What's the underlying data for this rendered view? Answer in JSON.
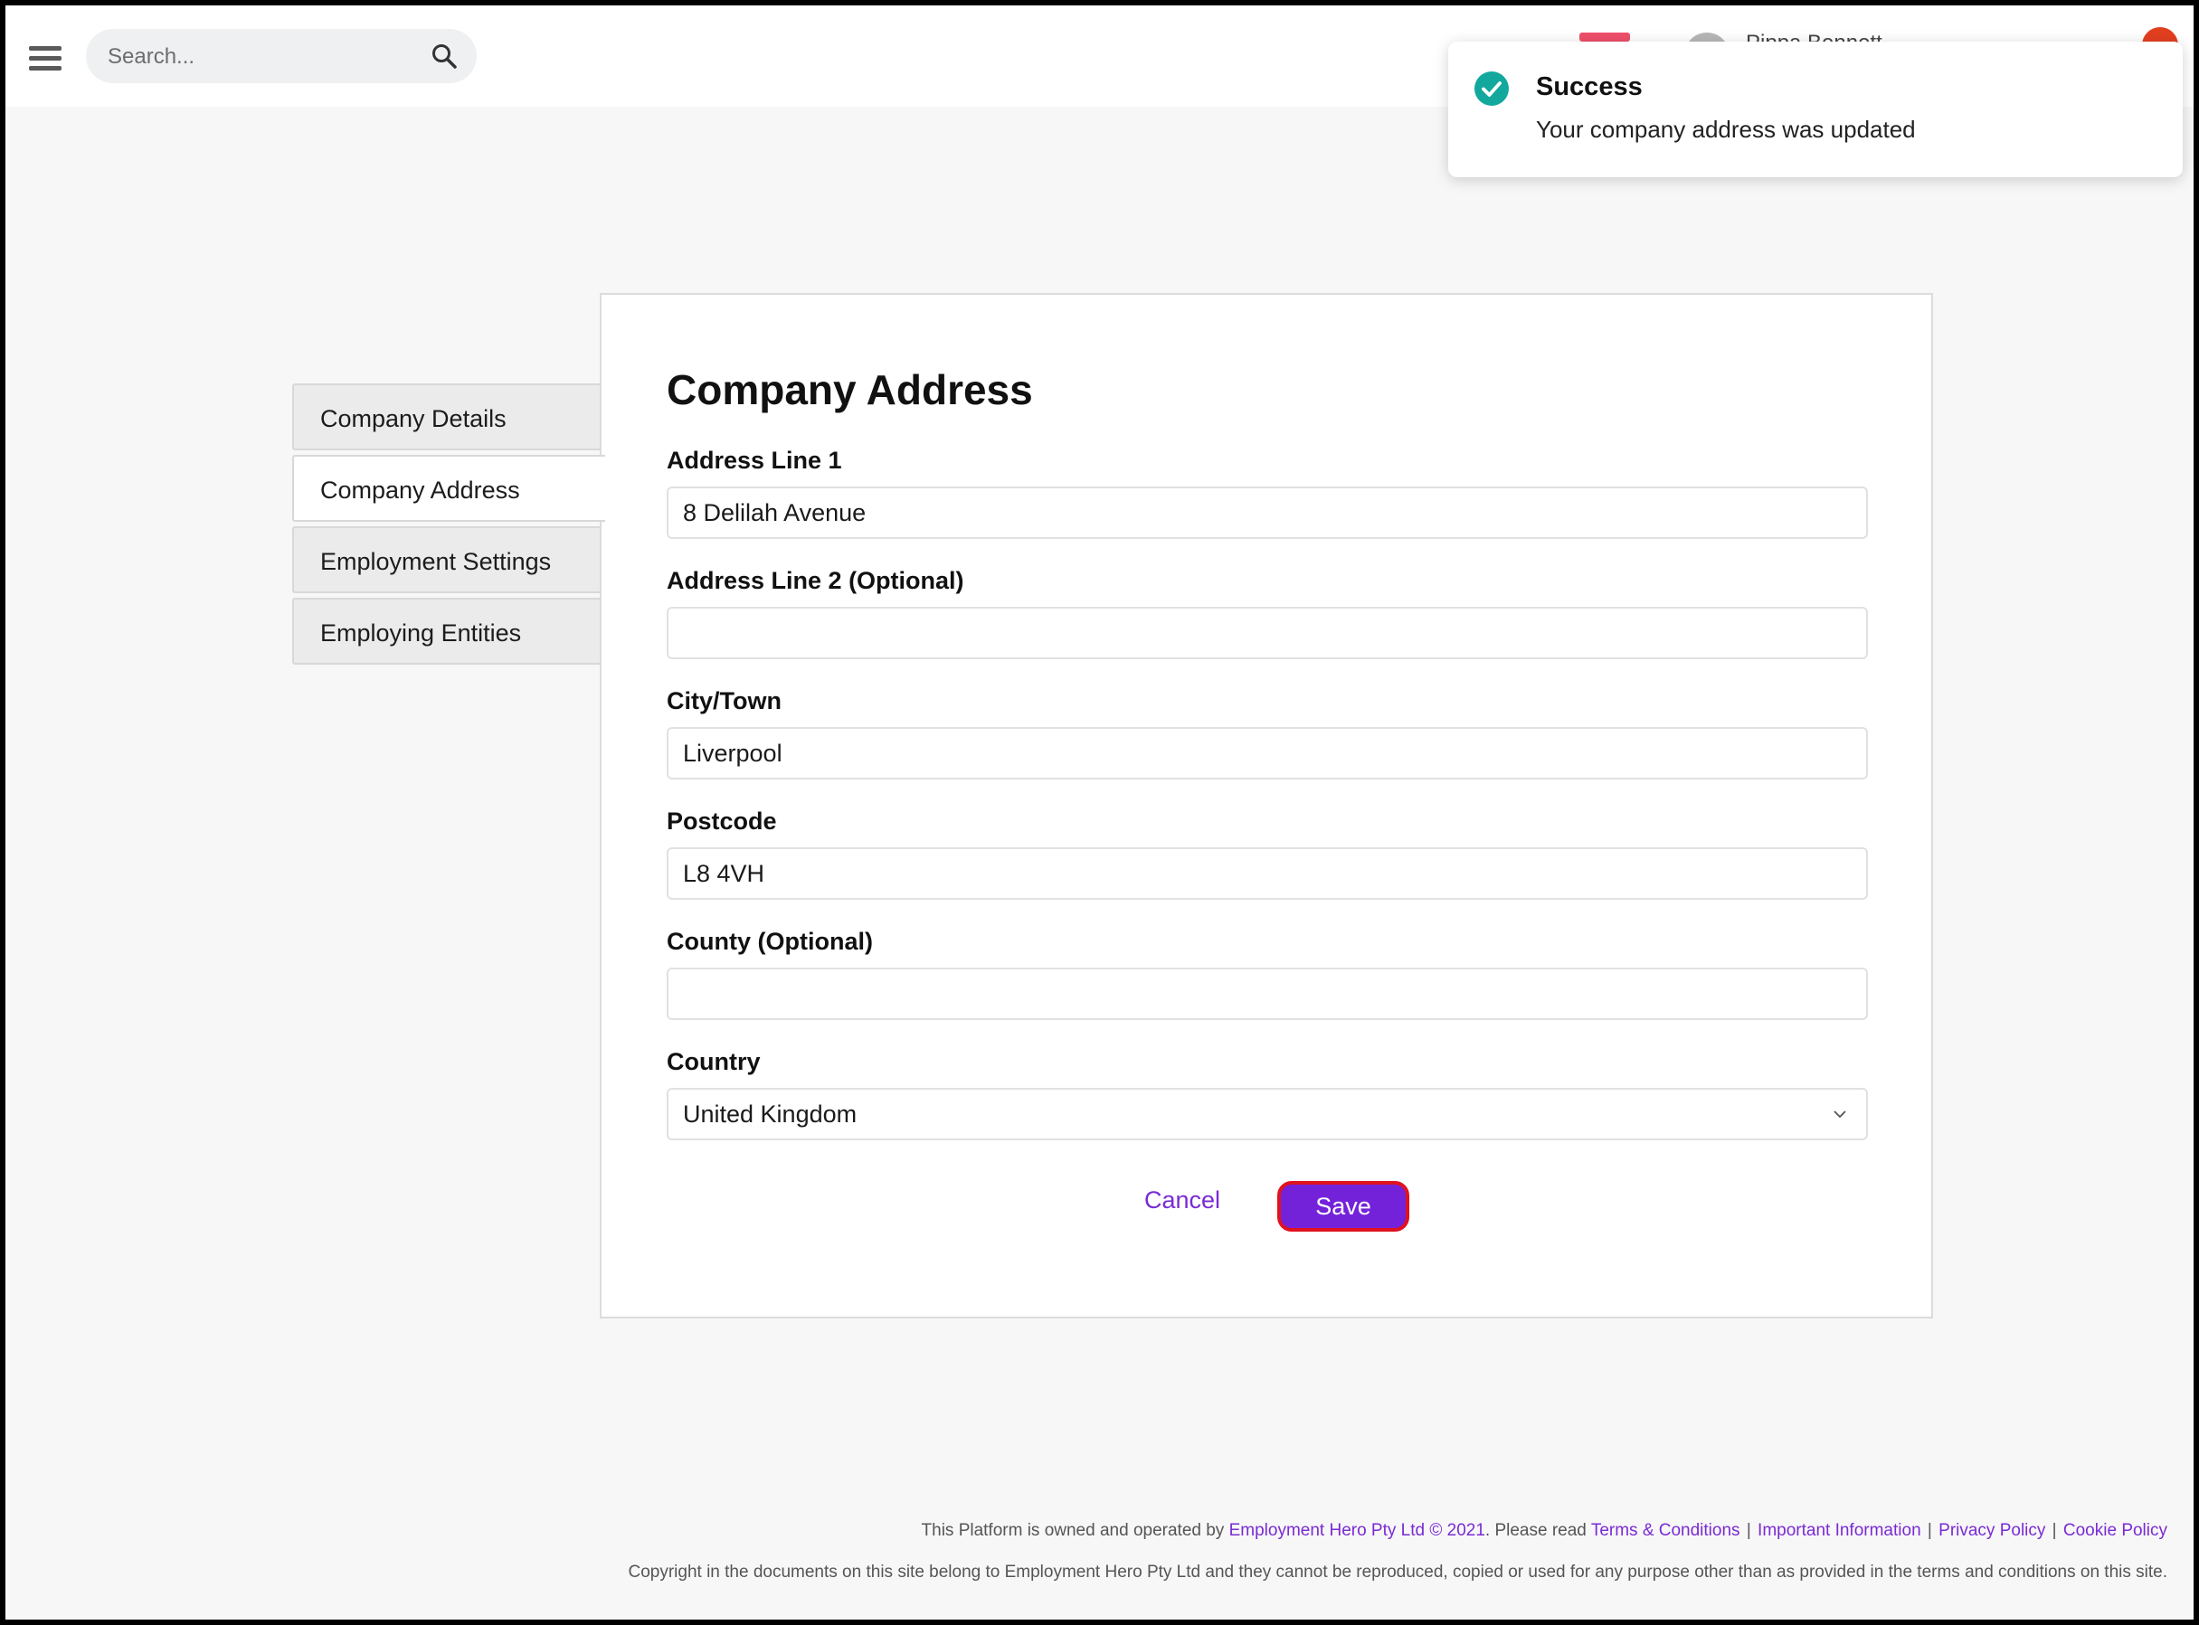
{
  "header": {
    "search_placeholder": "Search...",
    "user_name": "Pippa Bennett"
  },
  "toast": {
    "title": "Success",
    "message": "Your company address was updated",
    "color": "#13a89e"
  },
  "sidebar": {
    "items": [
      {
        "label": "Company Details",
        "active": false
      },
      {
        "label": "Company Address",
        "active": true
      },
      {
        "label": "Employment Settings",
        "active": false
      },
      {
        "label": "Employing Entities",
        "active": false
      }
    ]
  },
  "form": {
    "title": "Company Address",
    "address_line_1": {
      "label": "Address Line 1",
      "value": "8 Delilah Avenue"
    },
    "address_line_2": {
      "label": "Address Line 2 (Optional)",
      "value": ""
    },
    "city": {
      "label": "City/Town",
      "value": "Liverpool"
    },
    "postcode": {
      "label": "Postcode",
      "value": "L8 4VH"
    },
    "county": {
      "label": "County (Optional)",
      "value": ""
    },
    "country": {
      "label": "Country",
      "value": "United Kingdom"
    },
    "cancel_label": "Cancel",
    "save_label": "Save"
  },
  "footer": {
    "prefix": "This Platform is owned and operated by",
    "company_link": "Employment Hero Pty Ltd © 2021",
    "please_read": ". Please read",
    "terms": "Terms & Conditions",
    "important": "Important Information",
    "privacy": "Privacy Policy",
    "cookie": "Cookie Policy",
    "copyright": "Copyright in the documents on this site belong to Employment Hero Pty Ltd and they cannot be reproduced, copied or used for any purpose other than as provided in the terms and conditions on this site."
  },
  "colors": {
    "accent": "#7422d9",
    "link": "#7a2bd4",
    "save_outline": "#e0121f",
    "success": "#13a89e"
  }
}
